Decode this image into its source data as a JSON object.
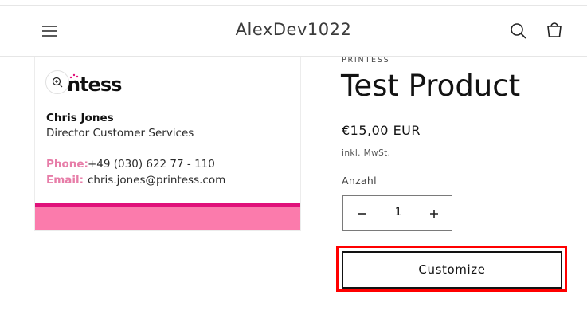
{
  "header": {
    "store_title": "AlexDev1022",
    "icons": [
      "menu-icon",
      "search-icon",
      "cart-icon"
    ]
  },
  "media": {
    "card": {
      "logo_text": "ntess",
      "name": "Chris Jones",
      "role": "Director Customer Services",
      "phone_label": "Phone:",
      "phone_value": "+49 (030) 622 77 - 110",
      "email_label": "Email:",
      "email_value": "chris.jones@printess.com"
    },
    "zoom_icon": "zoom-in-icon",
    "colors": {
      "stripe_dark": "#e0117a",
      "stripe_light": "#fb7bac",
      "label_pink": "#e77da8"
    }
  },
  "product": {
    "vendor": "PRINTESS",
    "title": "Test Product",
    "price": "€15,00 EUR",
    "tax_note": "inkl. MwSt.",
    "quantity_label": "Anzahl",
    "quantity_value": "1",
    "customize_label": "Customize",
    "highlight_color": "#ff0000"
  }
}
